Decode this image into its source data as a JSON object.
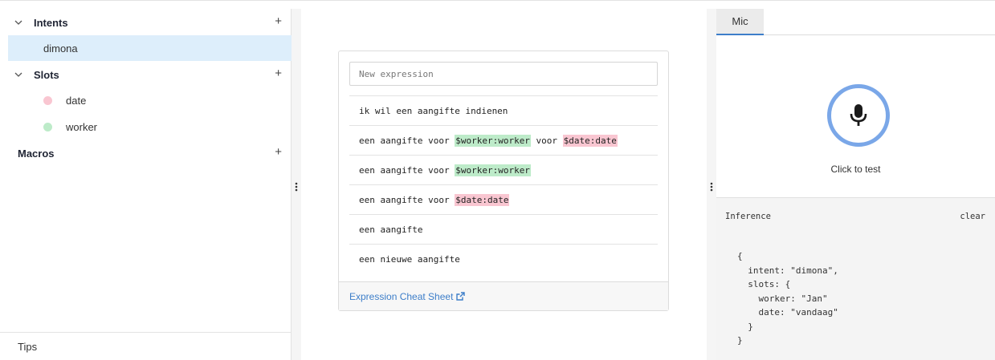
{
  "sidebar": {
    "intents_label": "Intents",
    "intents": [
      {
        "label": "dimona"
      }
    ],
    "slots_label": "Slots",
    "slots": [
      {
        "label": "date",
        "color": "#f9c6d1"
      },
      {
        "label": "worker",
        "color": "#bdebc9"
      }
    ],
    "macros_label": "Macros",
    "add_symbol": "+",
    "collapse_symbol": "⌄",
    "tips_label": "Tips"
  },
  "editor": {
    "new_expression_placeholder": "New expression",
    "expressions": [
      {
        "parts": [
          {
            "text": "ik wil een aangifte indienen"
          }
        ]
      },
      {
        "parts": [
          {
            "text": "een aangifte voor "
          },
          {
            "text": "$worker:worker",
            "tag": "green"
          },
          {
            "text": " voor "
          },
          {
            "text": "$date:date",
            "tag": "pink"
          }
        ]
      },
      {
        "parts": [
          {
            "text": "een aangifte voor "
          },
          {
            "text": "$worker:worker",
            "tag": "green"
          }
        ]
      },
      {
        "parts": [
          {
            "text": "een aangifte voor "
          },
          {
            "text": "$date:date",
            "tag": "pink"
          }
        ]
      },
      {
        "parts": [
          {
            "text": "een aangifte"
          }
        ]
      },
      {
        "parts": [
          {
            "text": "een nieuwe aangifte"
          }
        ]
      }
    ],
    "cheat_sheet_label": "Expression Cheat Sheet"
  },
  "test_panel": {
    "tab_label": "Mic",
    "click_to_test_label": "Click to test",
    "inference_label": "Inference",
    "clear_label": "clear",
    "inference_lines": [
      "{",
      "  intent: \"dimona\",",
      "  slots: {",
      "    worker: \"Jan\"",
      "    date: \"vandaag\"",
      "  }",
      "}"
    ]
  },
  "colors": {
    "accent": "#3d7ec9",
    "active_bg": "#ddeefb",
    "mic_ring": "#7aa7e8"
  }
}
